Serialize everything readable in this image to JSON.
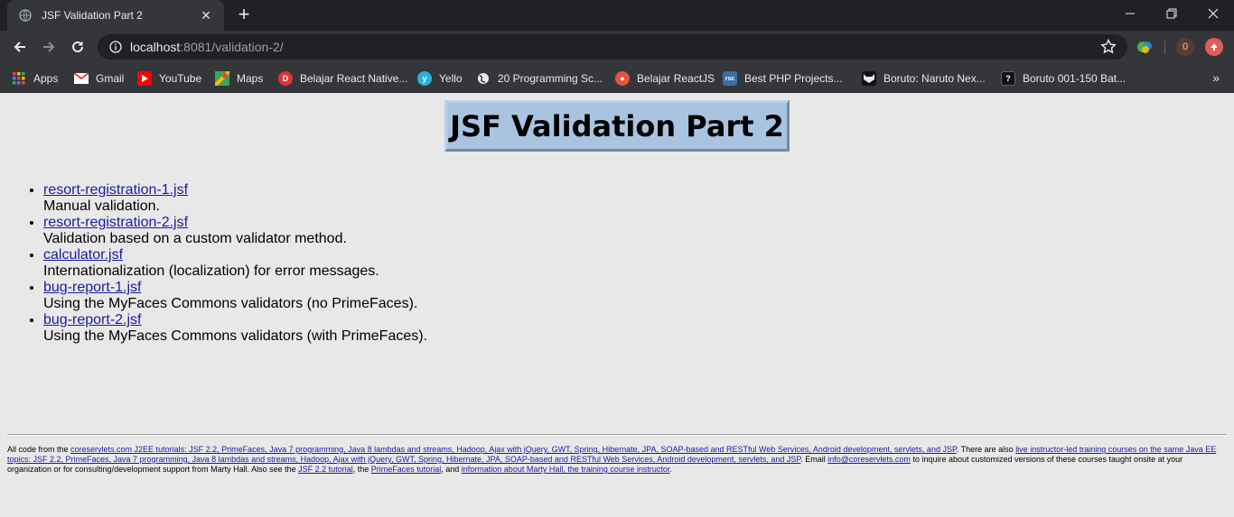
{
  "tab": {
    "title": "JSF Validation Part 2",
    "close": "×",
    "new_tab": "+"
  },
  "address": {
    "host": "localhost",
    "rest": ":8081/validation-2/"
  },
  "extensions": {
    "badge_count": "0"
  },
  "bookmarks": {
    "items": [
      {
        "label": "Apps",
        "icon": "apps-grid-icon"
      },
      {
        "label": "Gmail",
        "icon": "gmail-icon"
      },
      {
        "label": "YouTube",
        "icon": "youtube-icon"
      },
      {
        "label": "Maps",
        "icon": "maps-icon"
      },
      {
        "label": "Belajar React Native...",
        "icon": "site-icon"
      },
      {
        "label": "Yello",
        "icon": "site-icon"
      },
      {
        "label": "20 Programming Sc...",
        "icon": "globe-icon"
      },
      {
        "label": "Belajar ReactJS",
        "icon": "site-icon"
      },
      {
        "label": "Best PHP Projects...",
        "icon": "site-icon"
      },
      {
        "label": "Boruto: Naruto Nex...",
        "icon": "site-icon"
      },
      {
        "label": "Boruto 001-150 Bat...",
        "icon": "site-icon"
      }
    ],
    "more": "»"
  },
  "main": {
    "heading": "JSF Validation Part 2",
    "items": [
      {
        "link": "resort-registration-1.jsf",
        "desc": "Manual validation."
      },
      {
        "link": "resort-registration-2.jsf",
        "desc": "Validation based on a custom validator method."
      },
      {
        "link": "calculator.jsf",
        "desc": "Internationalization (localization) for error messages."
      },
      {
        "link": "bug-report-1.jsf",
        "desc": "Using the MyFaces Commons validators (no PrimeFaces)."
      },
      {
        "link": "bug-report-2.jsf",
        "desc": "Using the MyFaces Commons validators (with PrimeFaces)."
      }
    ]
  },
  "footer": {
    "t1": "All code from the ",
    "l1": "coreservlets.com J2EE tutorials: JSF 2.2, PrimeFaces, Java 7 programming, Java 8 lambdas and streams, Hadoop, Ajax with jQuery, GWT, Spring, Hibernate, JPA, SOAP-based and RESTful Web Services, Android development, servlets, and JSP",
    "t2": ". There are also ",
    "l2": "live instructor-led training courses on the same Java EE topics: JSF 2.2, PrimeFaces, Java 7 programming, Java 8 lambdas and streams, Hadoop, Ajax with jQuery, GWT, Spring, Hibernate, JPA, SOAP-based and RESTful Web Services, Android development, servlets, and JSP",
    "t3": ". Email ",
    "l3": "info@coreservlets.com",
    "t4": " to inquire about customized versions of these courses taught onsite at your organization or for consulting/development support from Marty Hall. Also see the ",
    "l4": "JSF 2.2 tutorial",
    "t5": ", the ",
    "l5": "PrimeFaces tutorial",
    "t6": ", and ",
    "l6": "information about Marty Hall, the training course instructor",
    "t7": "."
  },
  "colors": {
    "title_bg": "#a8c4e0",
    "link": "#1a1aa6",
    "chrome_dark": "#202124",
    "chrome": "#35363a"
  }
}
